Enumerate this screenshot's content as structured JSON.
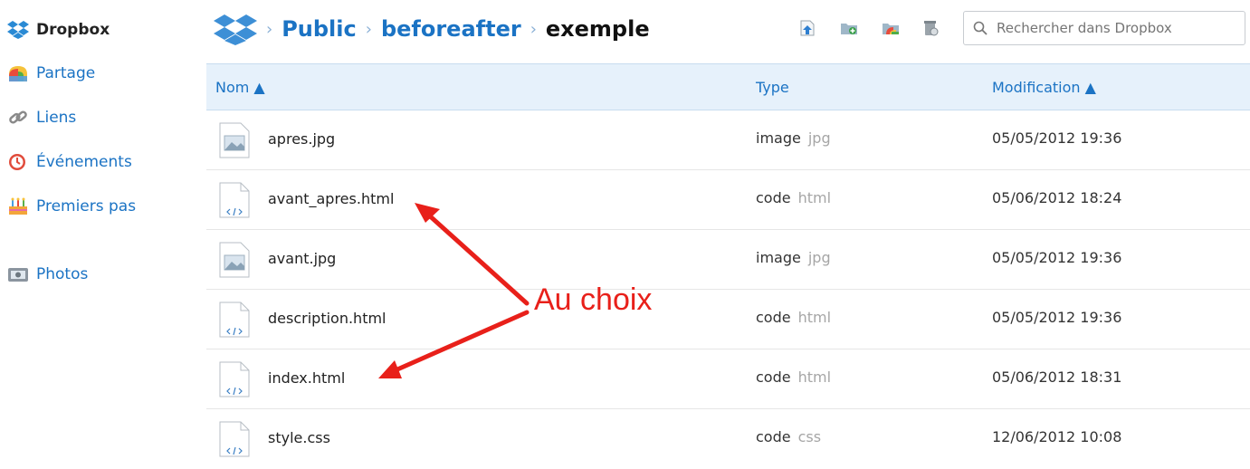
{
  "sidebar": {
    "items": [
      {
        "label": "Dropbox",
        "icon": "dropbox-icon",
        "active": true
      },
      {
        "label": "Partage",
        "icon": "rainbow-folder-icon"
      },
      {
        "label": "Liens",
        "icon": "link-chain-icon"
      },
      {
        "label": "Événements",
        "icon": "clock-icon"
      },
      {
        "label": "Premiers pas",
        "icon": "cake-icon"
      },
      {
        "label": "Photos",
        "icon": "photo-icon"
      }
    ]
  },
  "breadcrumb": {
    "items": [
      "Public",
      "beforeafter"
    ],
    "current": "exemple",
    "separator": "›"
  },
  "toolbar": {
    "icons": [
      "upload-icon",
      "new-folder-icon",
      "share-folder-icon",
      "deleted-files-icon"
    ]
  },
  "search": {
    "placeholder": "Rechercher dans Dropbox"
  },
  "columns": {
    "name": "Nom ▲",
    "type": "Type",
    "modified": "Modification ▲"
  },
  "files": [
    {
      "name": "apres.jpg",
      "type": "image",
      "ext": "jpg",
      "modified": "05/05/2012 19:36",
      "icon": "image-file-icon"
    },
    {
      "name": "avant_apres.html",
      "type": "code",
      "ext": "html",
      "modified": "05/06/2012 18:24",
      "icon": "code-file-icon"
    },
    {
      "name": "avant.jpg",
      "type": "image",
      "ext": "jpg",
      "modified": "05/05/2012 19:36",
      "icon": "image-file-icon"
    },
    {
      "name": "description.html",
      "type": "code",
      "ext": "html",
      "modified": "05/05/2012 19:36",
      "icon": "code-file-icon"
    },
    {
      "name": "index.html",
      "type": "code",
      "ext": "html",
      "modified": "05/06/2012 18:31",
      "icon": "code-file-icon"
    },
    {
      "name": "style.css",
      "type": "code",
      "ext": "css",
      "modified": "12/06/2012 10:08",
      "icon": "code-file-icon"
    }
  ],
  "annotation": {
    "label": "Au choix",
    "color": "#e8201a"
  },
  "colors": {
    "link": "#1b73c4",
    "header_bg": "#e6f1fb"
  }
}
